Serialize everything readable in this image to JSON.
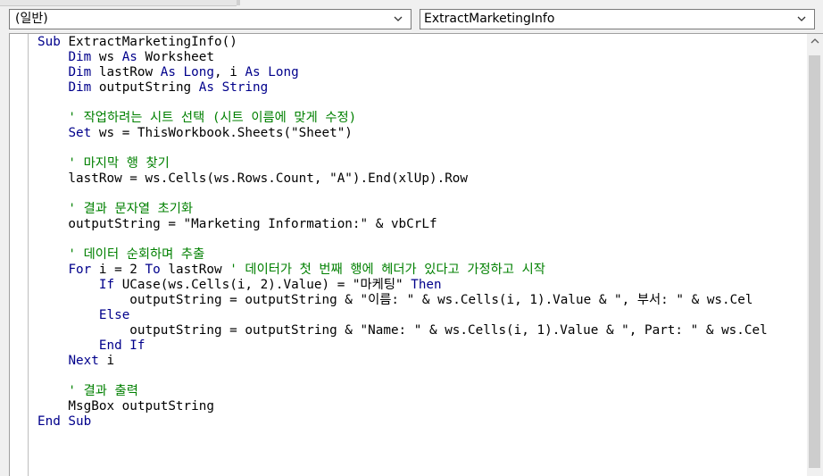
{
  "object_combo": {
    "value": "(일반)"
  },
  "procedure_combo": {
    "value": "ExtractMarketingInfo"
  },
  "code_lines": [
    [
      {
        "t": "Sub ",
        "c": "kw"
      },
      {
        "t": "ExtractMarketingInfo()",
        "c": "tx"
      }
    ],
    [
      {
        "t": "    ",
        "c": "tx"
      },
      {
        "t": "Dim",
        "c": "kw"
      },
      {
        "t": " ws ",
        "c": "tx"
      },
      {
        "t": "As",
        "c": "kw"
      },
      {
        "t": " Worksheet",
        "c": "tx"
      }
    ],
    [
      {
        "t": "    ",
        "c": "tx"
      },
      {
        "t": "Dim",
        "c": "kw"
      },
      {
        "t": " lastRow ",
        "c": "tx"
      },
      {
        "t": "As Long",
        "c": "kw"
      },
      {
        "t": ", i ",
        "c": "tx"
      },
      {
        "t": "As Long",
        "c": "kw"
      }
    ],
    [
      {
        "t": "    ",
        "c": "tx"
      },
      {
        "t": "Dim",
        "c": "kw"
      },
      {
        "t": " outputString ",
        "c": "tx"
      },
      {
        "t": "As String",
        "c": "kw"
      }
    ],
    [],
    [
      {
        "t": "    ' 작업하려는 시트 선택 (시트 이름에 맞게 수정)",
        "c": "cm"
      }
    ],
    [
      {
        "t": "    ",
        "c": "tx"
      },
      {
        "t": "Set",
        "c": "kw"
      },
      {
        "t": " ws = ThisWorkbook.Sheets(\"Sheet\")",
        "c": "tx"
      }
    ],
    [],
    [
      {
        "t": "    ' 마지막 행 찾기",
        "c": "cm"
      }
    ],
    [
      {
        "t": "    lastRow = ws.Cells(ws.Rows.Count, \"A\").End(xlUp).Row",
        "c": "tx"
      }
    ],
    [],
    [
      {
        "t": "    ' 결과 문자열 초기화",
        "c": "cm"
      }
    ],
    [
      {
        "t": "    outputString = \"Marketing Information:\" & vbCrLf",
        "c": "tx"
      }
    ],
    [],
    [
      {
        "t": "    ' 데이터 순회하며 추출",
        "c": "cm"
      }
    ],
    [
      {
        "t": "    ",
        "c": "tx"
      },
      {
        "t": "For",
        "c": "kw"
      },
      {
        "t": " i = 2 ",
        "c": "tx"
      },
      {
        "t": "To",
        "c": "kw"
      },
      {
        "t": " lastRow ",
        "c": "tx"
      },
      {
        "t": "' 데이터가 첫 번째 행에 헤더가 있다고 가정하고 시작",
        "c": "cm"
      }
    ],
    [
      {
        "t": "        ",
        "c": "tx"
      },
      {
        "t": "If",
        "c": "kw"
      },
      {
        "t": " UCase(ws.Cells(i, 2).Value) = \"마케팅\" ",
        "c": "tx"
      },
      {
        "t": "Then",
        "c": "kw"
      }
    ],
    [
      {
        "t": "            outputString = outputString & \"이름: \" & ws.Cells(i, 1).Value & \", 부서: \" & ws.Cel",
        "c": "tx"
      }
    ],
    [
      {
        "t": "        ",
        "c": "tx"
      },
      {
        "t": "Else",
        "c": "kw"
      }
    ],
    [
      {
        "t": "            outputString = outputString & \"Name: \" & ws.Cells(i, 1).Value & \", Part: \" & ws.Cel",
        "c": "tx"
      }
    ],
    [
      {
        "t": "        ",
        "c": "tx"
      },
      {
        "t": "End If",
        "c": "kw"
      }
    ],
    [
      {
        "t": "    ",
        "c": "tx"
      },
      {
        "t": "Next",
        "c": "kw"
      },
      {
        "t": " i",
        "c": "tx"
      }
    ],
    [],
    [
      {
        "t": "    ' 결과 출력",
        "c": "cm"
      }
    ],
    [
      {
        "t": "    MsgBox outputString",
        "c": "tx"
      }
    ],
    [
      {
        "t": "End Sub",
        "c": "kw"
      }
    ]
  ],
  "colors": {
    "keyword": "#00008b",
    "comment": "#008000",
    "text": "#000000"
  },
  "icons": {
    "combo_arrow": "chevron-down-icon",
    "scroll_up": "triangle-up-icon"
  }
}
